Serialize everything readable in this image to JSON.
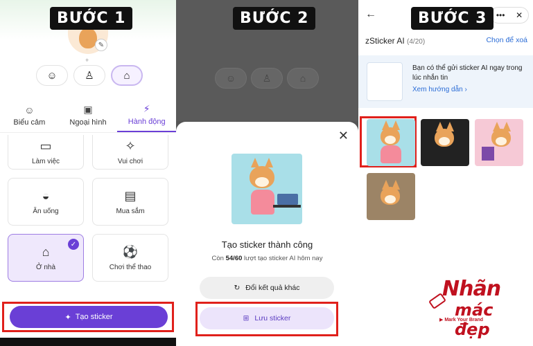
{
  "steps": {
    "s1": "BƯỚC 1",
    "s2": "BƯỚC 2",
    "s3": "BƯỚC 3"
  },
  "panel1": {
    "tabs": [
      {
        "label": "Biểu cảm",
        "icon": "smile-icon"
      },
      {
        "label": "Ngoại hình",
        "icon": "shirt-icon"
      },
      {
        "label": "Hành động",
        "icon": "running-icon"
      }
    ],
    "cards": [
      {
        "label": "Làm việc",
        "icon": "laptop-icon"
      },
      {
        "label": "Vui chơi",
        "icon": "party-icon"
      },
      {
        "label": "Ăn uống",
        "icon": "bowl-icon"
      },
      {
        "label": "Mua sắm",
        "icon": "shopping-bag-icon"
      },
      {
        "label": "Ở nhà",
        "icon": "house-icon"
      },
      {
        "label": "Chơi thể thao",
        "icon": "ball-icon"
      }
    ],
    "create_button": "Tạo sticker"
  },
  "panel2": {
    "title": "Tạo sticker thành công",
    "sub_prefix": "Còn ",
    "sub_count": "54/60",
    "sub_suffix": " lượt tạo sticker AI hôm nay",
    "retry_button": "Đổi kết quả khác",
    "save_button": "Lưu sticker"
  },
  "panel3": {
    "title": "zSticker AI",
    "count": "(4/20)",
    "select_delete": "Chọn để xoá",
    "promo_text": "Bạn có thể gửi sticker AI ngay trong lúc nhắn tin",
    "promo_link": "Xem hướng dẫn"
  },
  "brand": {
    "line1": "Nhãn",
    "line2": "mác đẹp",
    "tagline": "Mark Your Brand"
  },
  "colors": {
    "accent": "#6a3fd6",
    "highlight": "#e0201b",
    "brand": "#c0111f"
  }
}
